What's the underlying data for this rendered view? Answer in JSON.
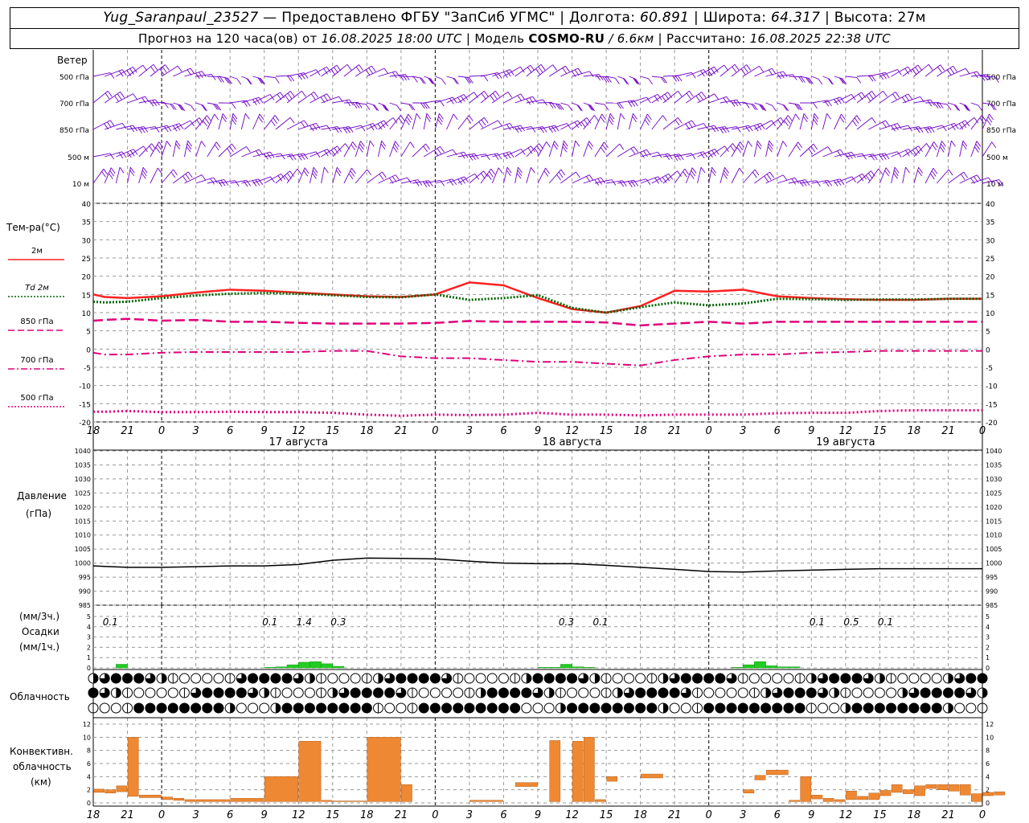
{
  "header": {
    "station": "Yug_Saranpaul_23527",
    "dash": "—",
    "provider": "Предоставлено ФГБУ \"ЗапСиб УГМС\"",
    "lon_label": "Долгота:",
    "lon_value": "60.891",
    "lat_label": "Широта:",
    "lat_value": "64.317",
    "alt_label": "Высота:",
    "alt_value": "27м",
    "forecast_label": "Прогноз на 120 часа(ов) от",
    "forecast_start": "16.08.2025 18:00 UTC",
    "model_label": "Модель",
    "model_name": "COSMO-RU",
    "model_res": "/ 6.6км",
    "calc_label": "Рассчитано:",
    "calc_time": "16.08.2025 22:38 UTC"
  },
  "time_axis": {
    "ticks": [
      "18",
      "21",
      "0",
      "3",
      "6",
      "9",
      "12",
      "15",
      "18",
      "21",
      "0",
      "3",
      "6",
      "9",
      "12",
      "15",
      "18",
      "21",
      "0",
      "3",
      "6",
      "9",
      "12",
      "15",
      "18",
      "21",
      "0"
    ],
    "days": [
      "17 августа",
      "18 августа",
      "19 августа"
    ]
  },
  "wind_panel": {
    "title": "Ветер",
    "levels": [
      "500 гПа",
      "700 гПа",
      "850 гПа",
      "500 м",
      "10  м"
    ],
    "colors": {
      "barb": "#7000c8"
    }
  },
  "temp_panel": {
    "title": "Тем-ра(°C)",
    "legend": [
      {
        "label": "2м",
        "color": "#ff2020",
        "style": "solid"
      },
      {
        "label": "Td  2м",
        "color": "#006400",
        "style": "dotted"
      },
      {
        "label": "850 гПа",
        "color": "#e0007a",
        "style": "dashed"
      },
      {
        "label": "700 гПа",
        "color": "#e0007a",
        "style": "dashdot"
      },
      {
        "label": "500 гПа",
        "color": "#e0007a",
        "style": "dotted"
      }
    ],
    "yticks": [
      "40",
      "35",
      "30",
      "25",
      "20",
      "15",
      "10",
      "5",
      "0",
      "-5",
      "-10",
      "-15",
      "-20"
    ]
  },
  "pressure_panel": {
    "title": "Давление",
    "unit": "(гПа)",
    "yticks": [
      "1040",
      "1035",
      "1030",
      "1025",
      "1020",
      "1015",
      "1010",
      "1005",
      "1000",
      "995",
      "990",
      "985"
    ]
  },
  "precip_panel": {
    "unit3": "(мм/3ч.)",
    "title": "Осадки",
    "unit1": "(мм/1ч.)",
    "yticks": [
      "5",
      "4",
      "3",
      "2",
      "1",
      "0"
    ],
    "totals": [
      {
        "h": 1.5,
        "text": "0.1"
      },
      {
        "h": 15.5,
        "text": "0.1"
      },
      {
        "h": 18.5,
        "text": "1.4"
      },
      {
        "h": 21.5,
        "text": "0.3"
      },
      {
        "h": 41.5,
        "text": "0.3"
      },
      {
        "h": 44.5,
        "text": "0.1"
      },
      {
        "h": 63.5,
        "text": "0.1"
      },
      {
        "h": 66.5,
        "text": "0.5"
      },
      {
        "h": 69.5,
        "text": "0.1"
      }
    ],
    "color": "#22cc22"
  },
  "cloud_panel": {
    "title": "Облачность"
  },
  "conv_panel": {
    "title1": "Конвективн.",
    "title2": "облачность",
    "unit": "(км)",
    "yticks": [
      "12",
      "10",
      "8",
      "6",
      "4",
      "2",
      "0"
    ],
    "color": "#ee8833"
  },
  "chart_data": [
    {
      "type": "line",
      "name": "temperature",
      "x_hours": [
        0,
        1,
        3,
        6,
        9,
        12,
        15,
        18,
        21,
        24,
        27,
        30,
        33,
        36,
        39,
        42,
        45,
        48,
        51,
        54,
        57,
        60,
        63,
        66,
        69,
        72,
        75,
        78
      ],
      "series": [
        {
          "name": "2м",
          "values": [
            15,
            14.3,
            14,
            14.5,
            15.5,
            16.3,
            16,
            15.5,
            15,
            14.5,
            14.3,
            15,
            18.3,
            17.5,
            14,
            11,
            10,
            11.8,
            16,
            15.8,
            16.3,
            14.5,
            14,
            13.7,
            13.5,
            13.5,
            13.8,
            13.8
          ]
        },
        {
          "name": "Td 2м",
          "values": [
            13,
            12.8,
            13,
            14,
            14.7,
            15.2,
            15.4,
            15.2,
            14.8,
            14.3,
            14.2,
            15,
            13.5,
            14,
            14.8,
            11.3,
            10,
            11.5,
            12.8,
            12,
            12.5,
            13.8,
            13.7,
            13.5,
            13.6,
            13.6,
            13.8,
            13.8
          ]
        },
        {
          "name": "850 гПа",
          "values": [
            7.8,
            8,
            8.3,
            7.8,
            8,
            7.5,
            7.5,
            7.2,
            7,
            7,
            7,
            7.2,
            7.7,
            7.5,
            7.5,
            7.5,
            7.3,
            6.5,
            7,
            7.5,
            7,
            7.5,
            7.5,
            7.5,
            7.5,
            7.5,
            7.5,
            7.5
          ]
        },
        {
          "name": "700 гПа",
          "values": [
            -1,
            -1.5,
            -1.5,
            -1,
            -0.8,
            -0.8,
            -0.8,
            -0.8,
            -0.5,
            -0.5,
            -2,
            -2.5,
            -2.5,
            -3,
            -3.5,
            -3.5,
            -4,
            -4.5,
            -3,
            -2,
            -1.5,
            -1.5,
            -1,
            -0.8,
            -0.5,
            -0.5,
            -0.5,
            -0.5
          ]
        },
        {
          "name": "500 гПа",
          "values": [
            -17.2,
            -17.2,
            -17,
            -17.3,
            -17.3,
            -17.2,
            -17.3,
            -17.3,
            -17.5,
            -18,
            -18.3,
            -18,
            -18.1,
            -18,
            -17.5,
            -18,
            -18,
            -18.2,
            -18,
            -18,
            -18,
            -17.6,
            -17.5,
            -17.5,
            -17,
            -16.8,
            -16.8,
            -16.8
          ]
        }
      ],
      "ylim": [
        -20,
        40
      ]
    },
    {
      "type": "line",
      "name": "pressure",
      "x_hours": [
        0,
        3,
        6,
        9,
        12,
        15,
        18,
        21,
        24,
        27,
        30,
        33,
        36,
        39,
        42,
        45,
        48,
        51,
        54,
        57,
        60,
        63,
        66,
        69,
        72,
        75,
        78
      ],
      "values": [
        999,
        998.5,
        998.5,
        998.7,
        999,
        999,
        999.5,
        1001,
        1001.8,
        1001.7,
        1001.5,
        1000.7,
        1000,
        999.8,
        999.8,
        999.2,
        998.5,
        997.8,
        997,
        996.8,
        997.2,
        997.5,
        997.8,
        998,
        998,
        998,
        998
      ],
      "ylim": [
        985,
        1040
      ]
    },
    {
      "type": "bar",
      "name": "precipitation",
      "x_hours": [
        2,
        15,
        16,
        17,
        18,
        19,
        20,
        21,
        39,
        40,
        41,
        42,
        43,
        56,
        57,
        58,
        59,
        60,
        61
      ],
      "values": [
        0.35,
        0.05,
        0.1,
        0.3,
        0.55,
        0.6,
        0.4,
        0.15,
        0.05,
        0.05,
        0.35,
        0.1,
        0.05,
        0.05,
        0.3,
        0.6,
        0.2,
        0.1,
        0.1
      ],
      "ylim": [
        0,
        5
      ]
    },
    {
      "type": "bar",
      "name": "convective_cloud_km",
      "bars": [
        {
          "x0": 0,
          "x1": 1,
          "bot": 1.6,
          "top": 2.1
        },
        {
          "x0": 1,
          "x1": 2,
          "bot": 1.5,
          "top": 2
        },
        {
          "x0": 2,
          "x1": 3,
          "bot": 1.7,
          "top": 2.6
        },
        {
          "x0": 3,
          "x1": 4,
          "bot": 1,
          "top": 10
        },
        {
          "x0": 4,
          "x1": 6,
          "bot": 0.8,
          "top": 1.2
        },
        {
          "x0": 6,
          "x1": 7,
          "bot": 0.5,
          "top": 0.9
        },
        {
          "x0": 7,
          "x1": 8,
          "bot": 0.4,
          "top": 0.7
        },
        {
          "x0": 8,
          "x1": 9,
          "bot": 0.2,
          "top": 0.5
        },
        {
          "x0": 9,
          "x1": 12,
          "bot": 0.2,
          "top": 0.5
        },
        {
          "x0": 12,
          "x1": 15,
          "bot": 0.2,
          "top": 0.7
        },
        {
          "x0": 15,
          "x1": 18,
          "bot": 0.2,
          "top": 4
        },
        {
          "x0": 18,
          "x1": 20,
          "bot": 0.2,
          "top": 9.4
        },
        {
          "x0": 20,
          "x1": 21,
          "bot": 0.2,
          "top": 0.4
        },
        {
          "x0": 21,
          "x1": 24,
          "bot": 0.2,
          "top": 0.3
        },
        {
          "x0": 24,
          "x1": 27,
          "bot": 0.2,
          "top": 10
        },
        {
          "x0": 27,
          "x1": 28,
          "bot": 0.2,
          "top": 2.8
        },
        {
          "x0": 33,
          "x1": 36,
          "bot": 0.2,
          "top": 0.4
        },
        {
          "x0": 37,
          "x1": 39,
          "bot": 2.5,
          "top": 3.1
        },
        {
          "x0": 40,
          "x1": 41,
          "bot": 0.2,
          "top": 9.5
        },
        {
          "x0": 42,
          "x1": 43,
          "bot": 0.2,
          "top": 9.4
        },
        {
          "x0": 43,
          "x1": 44,
          "bot": 0.2,
          "top": 10
        },
        {
          "x0": 44,
          "x1": 45,
          "bot": 0.2,
          "top": 0.5
        },
        {
          "x0": 45,
          "x1": 46,
          "bot": 3.3,
          "top": 4
        },
        {
          "x0": 48,
          "x1": 50,
          "bot": 3.8,
          "top": 4.4
        },
        {
          "x0": 57,
          "x1": 58,
          "bot": 1.5,
          "top": 2
        },
        {
          "x0": 58,
          "x1": 59,
          "bot": 3.5,
          "top": 4.2
        },
        {
          "x0": 59,
          "x1": 61,
          "bot": 4.3,
          "top": 5
        },
        {
          "x0": 61,
          "x1": 62,
          "bot": 0.2,
          "top": 0.4
        },
        {
          "x0": 62,
          "x1": 63,
          "bot": 0.2,
          "top": 4
        },
        {
          "x0": 63,
          "x1": 64,
          "bot": 0.6,
          "top": 1.2
        },
        {
          "x0": 64,
          "x1": 65,
          "bot": 0.2,
          "top": 0.7
        },
        {
          "x0": 65,
          "x1": 66,
          "bot": 0.2,
          "top": 0.5
        },
        {
          "x0": 66,
          "x1": 67,
          "bot": 0.5,
          "top": 1.8
        },
        {
          "x0": 67,
          "x1": 68,
          "bot": 0.5,
          "top": 1
        },
        {
          "x0": 68,
          "x1": 69,
          "bot": 0.5,
          "top": 1.5
        },
        {
          "x0": 69,
          "x1": 70,
          "bot": 1.1,
          "top": 1.9
        },
        {
          "x0": 70,
          "x1": 71,
          "bot": 1.6,
          "top": 2.8
        },
        {
          "x0": 71,
          "x1": 72,
          "bot": 1.4,
          "top": 2
        },
        {
          "x0": 72,
          "x1": 73,
          "bot": 1.1,
          "top": 2.6
        },
        {
          "x0": 73,
          "x1": 74,
          "bot": 2.2,
          "top": 2.8
        },
        {
          "x0": 74,
          "x1": 75,
          "bot": 2,
          "top": 2.8
        },
        {
          "x0": 75,
          "x1": 76,
          "bot": 1.8,
          "top": 2.8
        },
        {
          "x0": 76,
          "x1": 77,
          "bot": 1.2,
          "top": 2.8
        },
        {
          "x0": 77,
          "x1": 78,
          "bot": 0.2,
          "top": 1.4
        },
        {
          "x0": 78,
          "x1": 79,
          "bot": 1.1,
          "top": 1.6
        },
        {
          "x0": 79,
          "x1": 80,
          "bot": 1.2,
          "top": 1.7
        }
      ],
      "ylim": [
        0,
        12
      ]
    }
  ]
}
